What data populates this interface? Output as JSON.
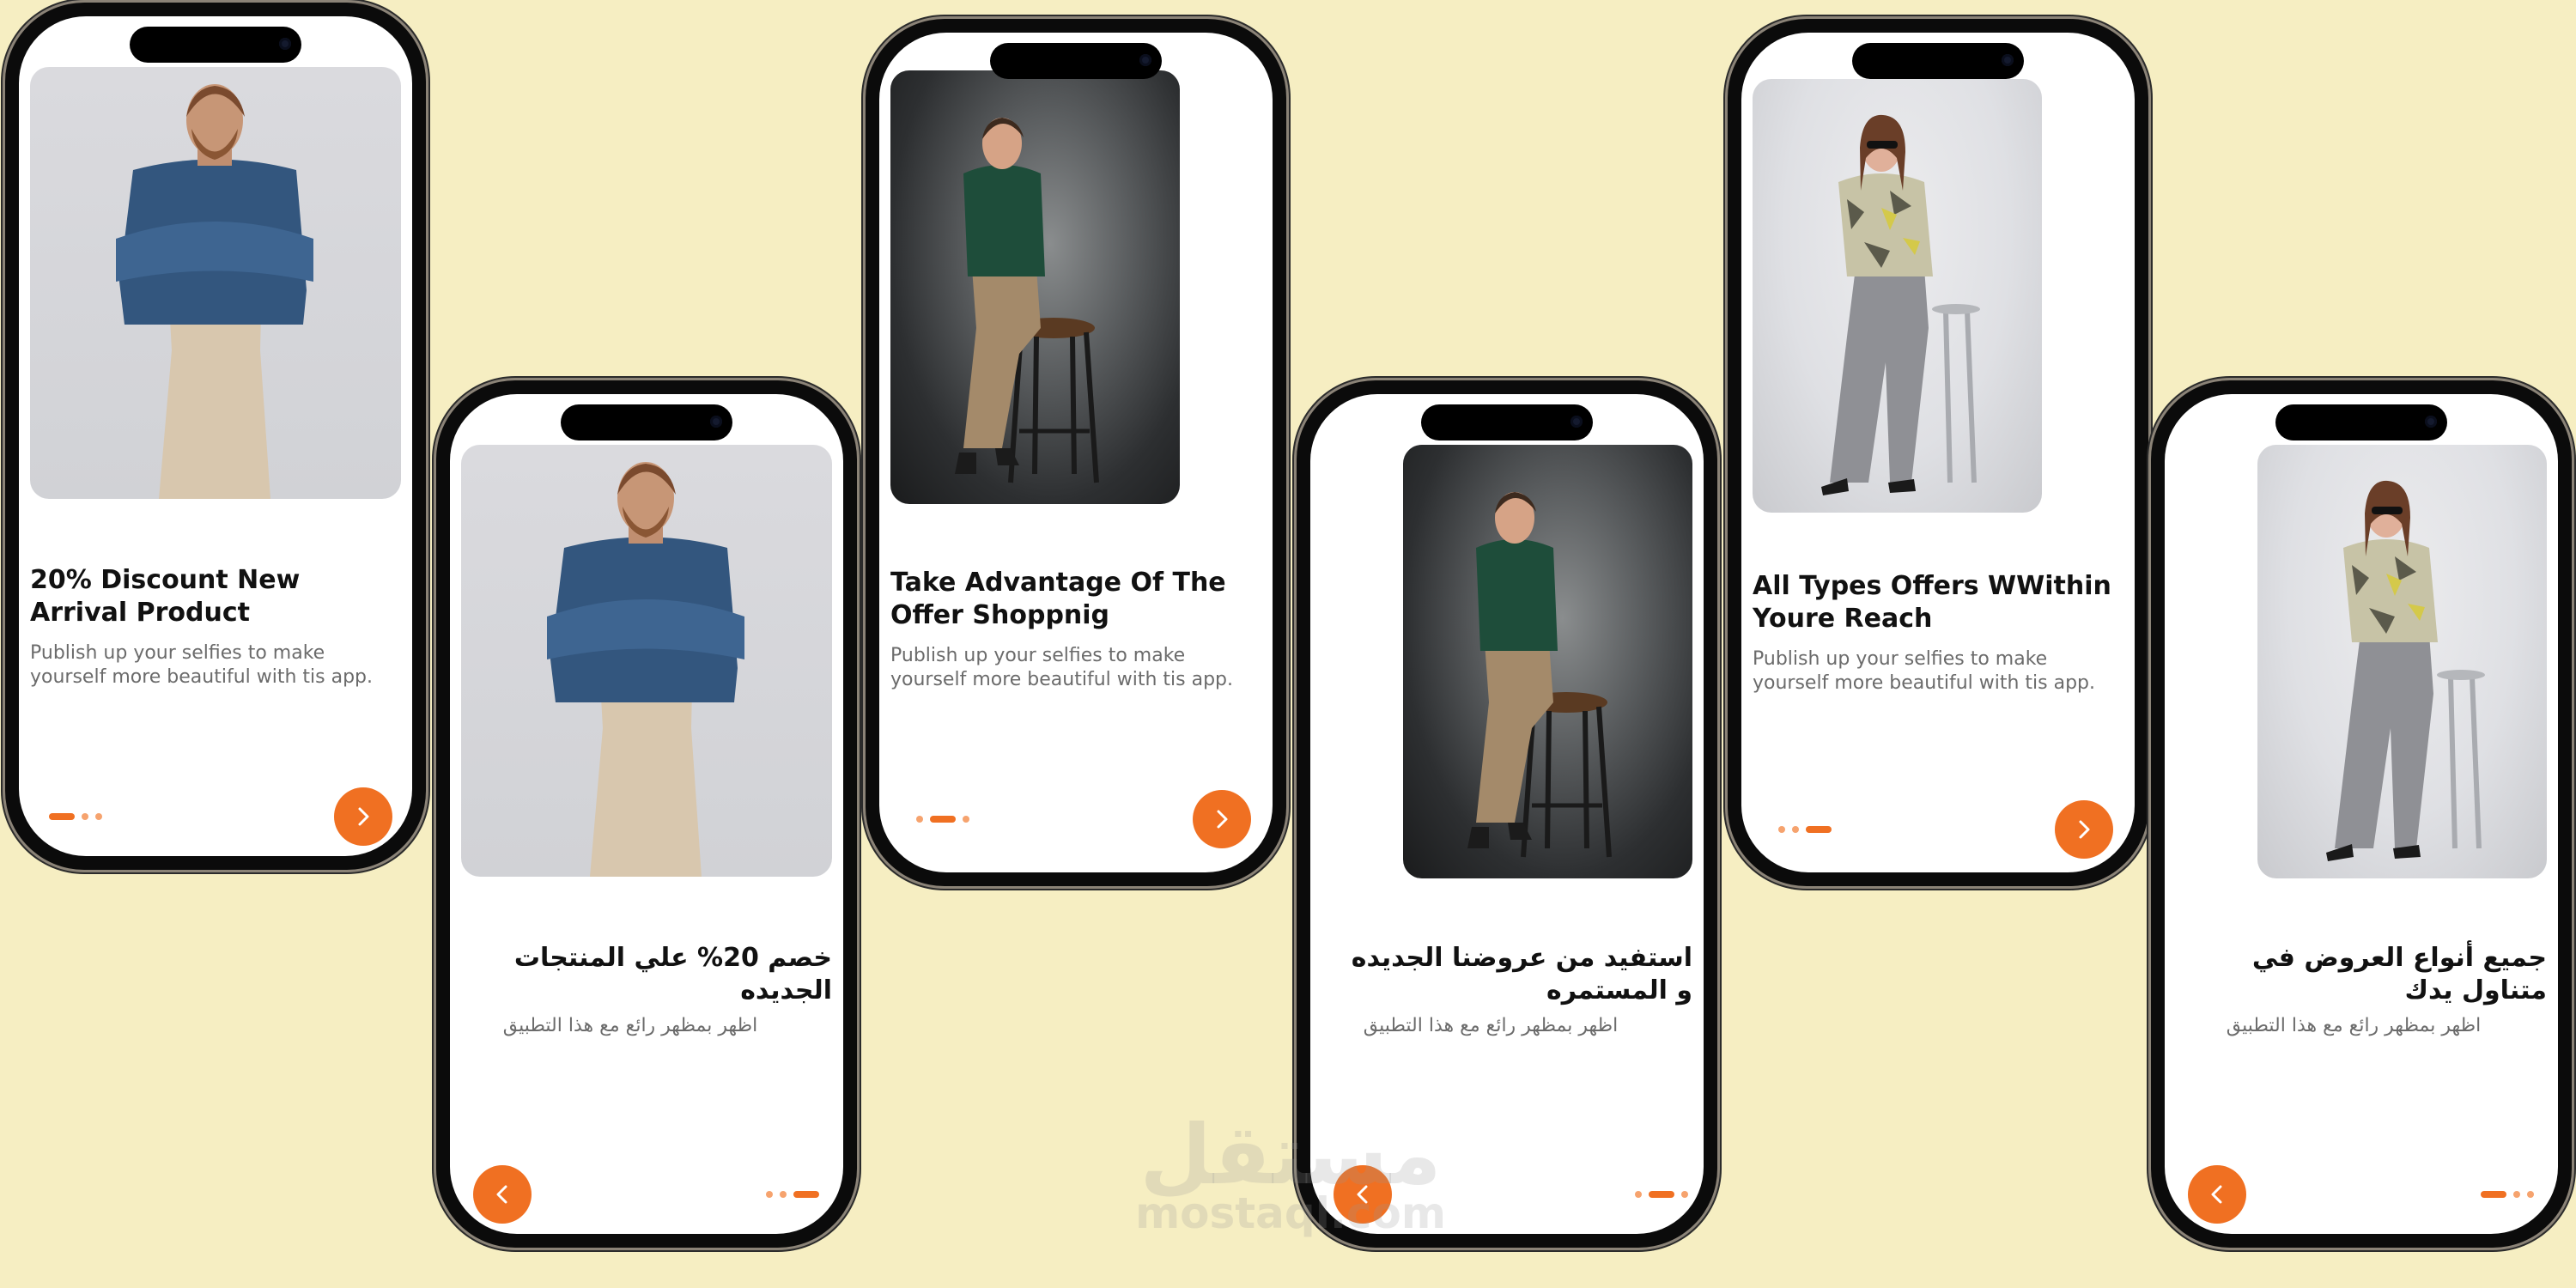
{
  "screens": [
    {
      "title": "20% Discount New Arrival Product",
      "description": "Publish up your selfies to make yourself more beautiful with tis app.",
      "image": "man-denim-shirt-photo",
      "dots": [
        true,
        false,
        false
      ],
      "nav": "next-arrow-icon"
    },
    {
      "title": "خصم 20% علي المنتجات الجديده",
      "description": "اظهر بمظهر رائع مع هذا التطبيق",
      "image": "man-denim-shirt-photo",
      "dots": [
        false,
        false,
        true
      ],
      "nav": "back-arrow-icon"
    },
    {
      "title": "Take Advantage Of The Offer Shoppnig",
      "description": "Publish up your selfies to make yourself more beautiful with tis app.",
      "image": "man-green-shirt-stool-photo",
      "dots": [
        false,
        true,
        false
      ],
      "nav": "next-arrow-icon"
    },
    {
      "title": "استفيد من عروضنا الجديده و المستمره",
      "description": "اظهر بمظهر رائع مع هذا التطبيق",
      "image": "man-green-shirt-stool-photo",
      "dots": [
        false,
        true,
        false
      ],
      "nav": "back-arrow-icon"
    },
    {
      "title": "All Types Offers WWithin Youre Reach",
      "description": "Publish up your selfies to make yourself more beautiful with tis app.",
      "image": "woman-sunglasses-stool-photo",
      "dots": [
        false,
        false,
        true
      ],
      "nav": "next-arrow-icon"
    },
    {
      "title": "جميع أنواع العروض في متناول يدك",
      "description": "اظهر بمظهر رائع مع هذا التطبيق",
      "image": "woman-sunglasses-stool-photo",
      "dots": [
        true,
        false,
        false
      ],
      "nav": "back-arrow-icon"
    }
  ],
  "watermark": {
    "arabic": "مستقل",
    "latin": "mostaql.com"
  },
  "colors": {
    "background": "#f6eec2",
    "accent": "#f07022",
    "accent_light": "#f6a36e",
    "frame": "#0b0b0b"
  }
}
